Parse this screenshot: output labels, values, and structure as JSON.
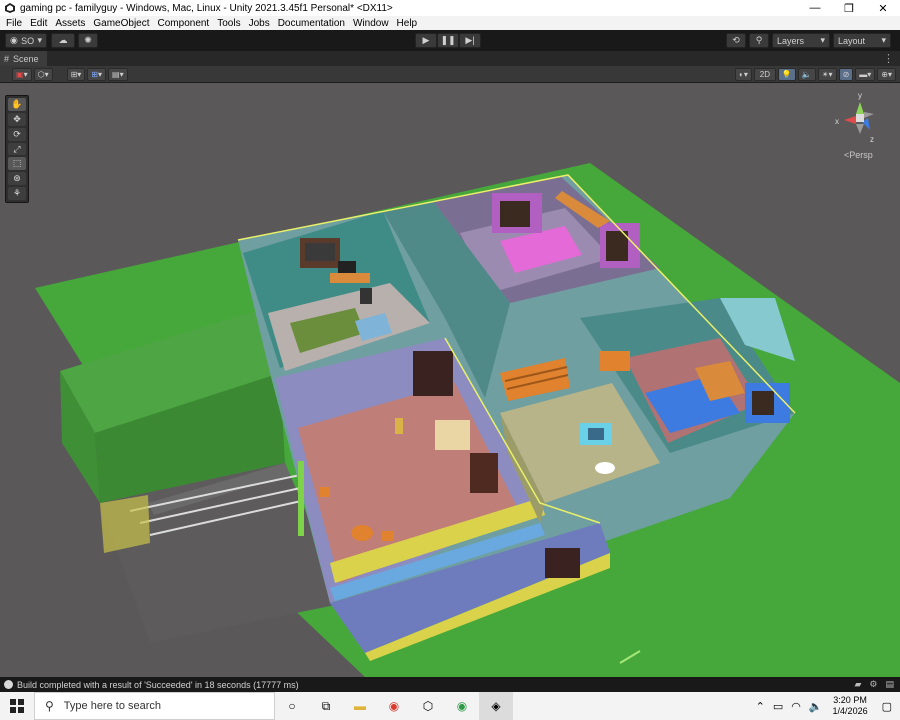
{
  "window": {
    "title": "gaming pc - familyguy - Windows, Mac, Linux - Unity 2021.3.45f1 Personal* <DX11>",
    "minimize": "—",
    "maximize": "❐",
    "close": "✕"
  },
  "menu": [
    "File",
    "Edit",
    "Assets",
    "GameObject",
    "Component",
    "Tools",
    "Jobs",
    "Documentation",
    "Window",
    "Help"
  ],
  "toolbar": {
    "account_label": "SO",
    "layers_label": "Layers",
    "layout_label": "Layout"
  },
  "scene_tab": {
    "label": "Scene"
  },
  "scene_toolbar": {
    "mode_2d_label": "2D"
  },
  "gizmo": {
    "x": "x",
    "y": "y",
    "z": "z",
    "persp": "<Persp"
  },
  "status": {
    "message": "Build completed with a result of 'Succeeded' in 18 seconds (17777 ms)"
  },
  "taskbar": {
    "search_placeholder": "Type here to search",
    "time": "3:20 PM",
    "date": "1/4/2026"
  },
  "colors": {
    "accent": "#2d7df6",
    "grass": "#46a83a",
    "scene_bg": "#5b5859"
  }
}
